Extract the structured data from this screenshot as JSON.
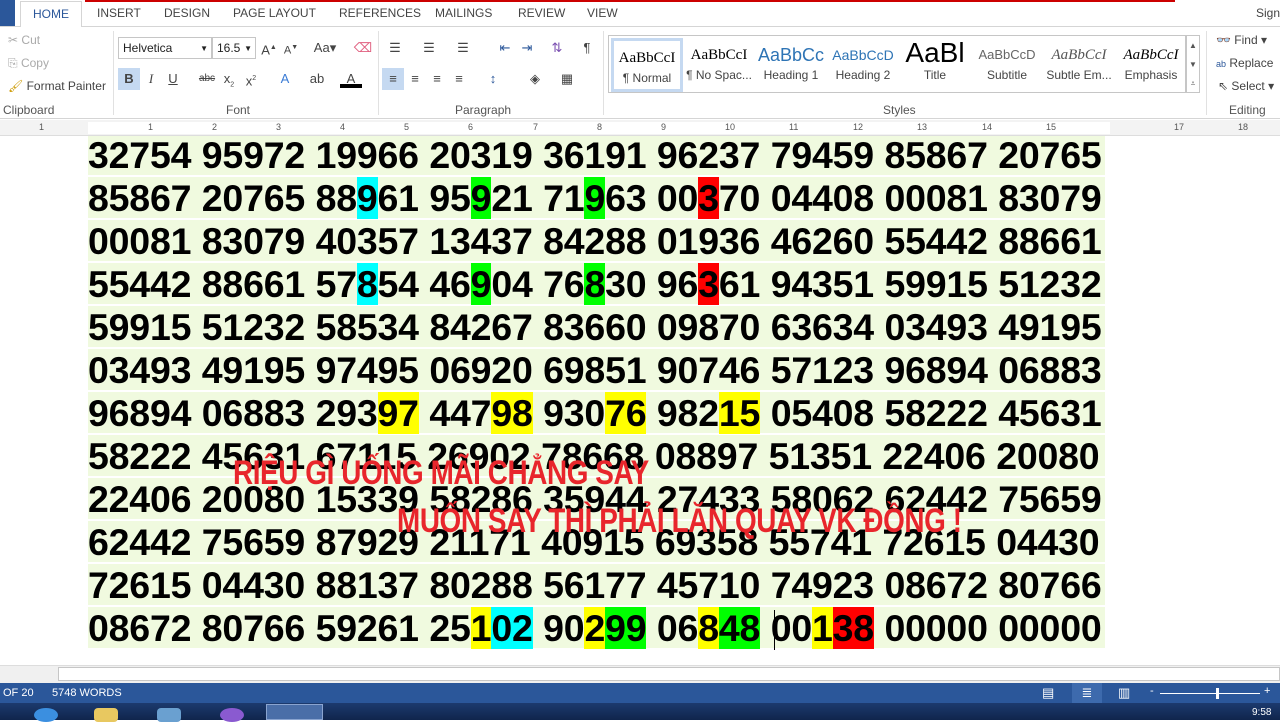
{
  "tabs": [
    "HOME",
    "INSERT",
    "DESIGN",
    "PAGE LAYOUT",
    "REFERENCES",
    "MAILINGS",
    "REVIEW",
    "VIEW"
  ],
  "sign_in": "Sign",
  "clipboard": {
    "cut": "Cut",
    "copy": "Copy",
    "format_painter": "Format Painter",
    "label": "Clipboard"
  },
  "font": {
    "name": "Helvetica",
    "size": "16.5",
    "label": "Font",
    "case_btn": "Aa"
  },
  "paragraph": {
    "label": "Paragraph"
  },
  "styles": {
    "label": "Styles",
    "items": [
      {
        "preview": "AaBbCcI",
        "name": "¶ Normal"
      },
      {
        "preview": "AaBbCcI",
        "name": "¶ No Spac..."
      },
      {
        "preview": "AaBbCc",
        "name": "Heading 1"
      },
      {
        "preview": "AaBbCcD",
        "name": "Heading 2"
      },
      {
        "preview": "AaBl",
        "name": "Title"
      },
      {
        "preview": "AaBbCcD",
        "name": "Subtitle"
      },
      {
        "preview": "AaBbCcI",
        "name": "Subtle Em..."
      },
      {
        "preview": "AaBbCcI",
        "name": "Emphasis"
      }
    ]
  },
  "editing": {
    "find": "Find",
    "replace": "Replace",
    "select": "Select",
    "label": "Editing"
  },
  "ruler": [
    "1",
    "1",
    "2",
    "3",
    "4",
    "5",
    "6",
    "7",
    "8",
    "9",
    "10",
    "11",
    "12",
    "13",
    "14",
    "15",
    "17",
    "18"
  ],
  "colors": {
    "yellow": "#ffff00",
    "cyan": "#00ffff",
    "green": "#00ff00",
    "red": "#ff0000",
    "overlay": "#e8262c",
    "accent": "#2b579a"
  },
  "document": {
    "rows": [
      [
        "32754",
        "95972",
        "19966",
        "20319",
        "36191",
        "96237",
        "79459",
        "85867",
        "20765"
      ],
      [
        "85867",
        "20765",
        [
          [
            "88"
          ],
          [
            "9",
            "cyan"
          ],
          [
            "61"
          ]
        ],
        [
          [
            "95"
          ],
          [
            "9",
            "green"
          ],
          [
            "21"
          ]
        ],
        [
          [
            "71"
          ],
          [
            "9",
            "green"
          ],
          [
            "63"
          ]
        ],
        [
          [
            "00"
          ],
          [
            "3",
            "red"
          ],
          [
            "70"
          ]
        ],
        "04408",
        "00081",
        "83079"
      ],
      [
        "00081",
        "83079",
        "40357",
        "13437",
        "84288",
        "01936",
        "46260",
        "55442",
        "88661"
      ],
      [
        "55442",
        "88661",
        [
          [
            "57"
          ],
          [
            "8",
            "cyan"
          ],
          [
            "54"
          ]
        ],
        [
          [
            "46"
          ],
          [
            "9",
            "green"
          ],
          [
            "04"
          ]
        ],
        [
          [
            "76"
          ],
          [
            "8",
            "green"
          ],
          [
            "30"
          ]
        ],
        [
          [
            "96"
          ],
          [
            "3",
            "red"
          ],
          [
            "61"
          ]
        ],
        "94351",
        "59915",
        "51232"
      ],
      [
        "59915",
        "51232",
        "58534",
        "84267",
        "83660",
        "09870",
        "63634",
        "03493",
        "49195"
      ],
      [
        "03493",
        "49195",
        "97495",
        "06920",
        "69851",
        "90746",
        "57123",
        "96894",
        "06883"
      ],
      [
        "96894",
        "06883",
        [
          [
            "293"
          ],
          [
            "97",
            "yellow"
          ]
        ],
        [
          [
            "447"
          ],
          [
            "98",
            "yellow"
          ]
        ],
        [
          [
            "930"
          ],
          [
            "76",
            "yellow"
          ]
        ],
        [
          [
            "982"
          ],
          [
            "15",
            "yellow"
          ]
        ],
        "05408",
        "58222",
        "45631"
      ],
      [
        "58222",
        "45631",
        "67115",
        "26902",
        "78668",
        "08897",
        "51351",
        "22406",
        "20080"
      ],
      [
        "22406",
        "20080",
        "15339",
        "58286",
        "35944",
        "27433",
        "58062",
        "62442",
        "75659"
      ],
      [
        "62442",
        "75659",
        "87929",
        "21171",
        "40915",
        "69358",
        "55741",
        "72615",
        "04430"
      ],
      [
        "72615",
        "04430",
        "88137",
        "80288",
        "56177",
        "45710",
        "74923",
        "08672",
        "80766"
      ],
      [
        "08672",
        "80766",
        "59261",
        [
          [
            "25"
          ],
          [
            "1",
            "yellow"
          ],
          [
            "02",
            "cyan"
          ]
        ],
        [
          [
            "90"
          ],
          [
            "2",
            "yellow"
          ],
          [
            "99",
            "green"
          ]
        ],
        [
          [
            "06"
          ],
          [
            "8",
            "yellow"
          ],
          [
            "48",
            "green"
          ]
        ],
        [
          [
            "00"
          ],
          [
            "1",
            "yellow"
          ],
          [
            "38",
            "red"
          ]
        ],
        "00000",
        "00000"
      ]
    ],
    "overlay_line1": "RIỆU GÌ UỐNG MÃI CHẲNG SAY",
    "overlay_line2": "MUỐN SAY THÌ PHẢI LĂN QUAY VK ĐỒNG !"
  },
  "status": {
    "page": "OF 20",
    "words": "5748 WORDS"
  },
  "clock": "9:58"
}
